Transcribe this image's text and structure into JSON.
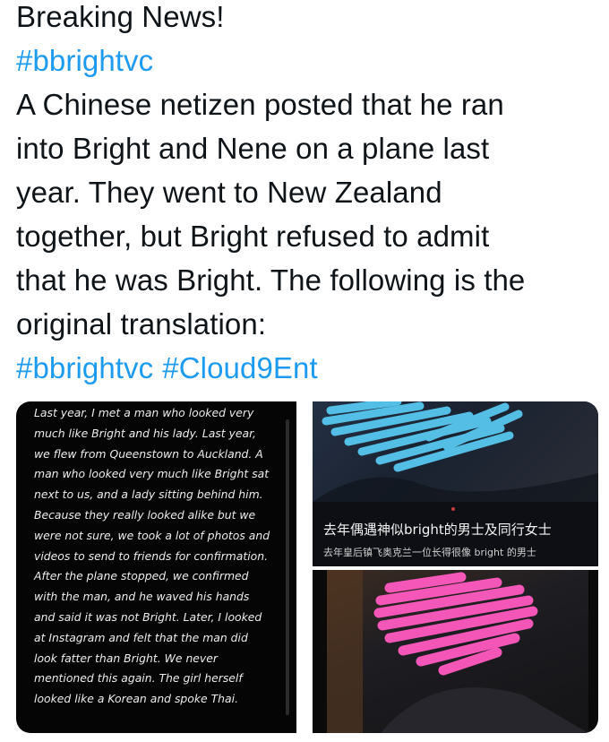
{
  "tweet": {
    "lines": [
      "Breaking News!",
      "A Chinese netizen posted that he ran",
      "into Bright and Nene on a plane last",
      "year. They went to New Zealand",
      "together, but Bright refused to admit",
      "that he was Bright. The following is the",
      "original translation:"
    ],
    "hashtag_first": "#bbrightvc",
    "hashtags_end": [
      "#bbrightvc",
      "#Cloud9Ent"
    ],
    "link_color": "#1d9bf0"
  },
  "media": {
    "left_caption": [
      "Last year, I met a man who looked very",
      "much like Bright and his lady. Last year,",
      "we flew from Queenstown to Auckland. A",
      "man who looked very much like Bright sat",
      "next to us, and a lady sitting behind him.",
      "Because they really looked alike but we",
      "were not sure, we took a lot of photos and",
      "videos to send to friends for confirmation.",
      "After the plane stopped, we confirmed",
      "with the man, and he waved his hands",
      "and said it was not Bright. Later, I looked",
      "at Instagram and felt that the man did",
      "look fatter than Bright. We never",
      "mentioned this again. The girl herself",
      "looked like a Korean and spoke Thai."
    ],
    "zh_title": "去年偶遇神似bright的男士及同行女士",
    "zh_subtitle": "去年皇后镇飞奥克兰一位长得很像 bright 的男士",
    "scribble_colors": {
      "blue": "#58c8f0",
      "pink": "#ff5ac0"
    }
  }
}
